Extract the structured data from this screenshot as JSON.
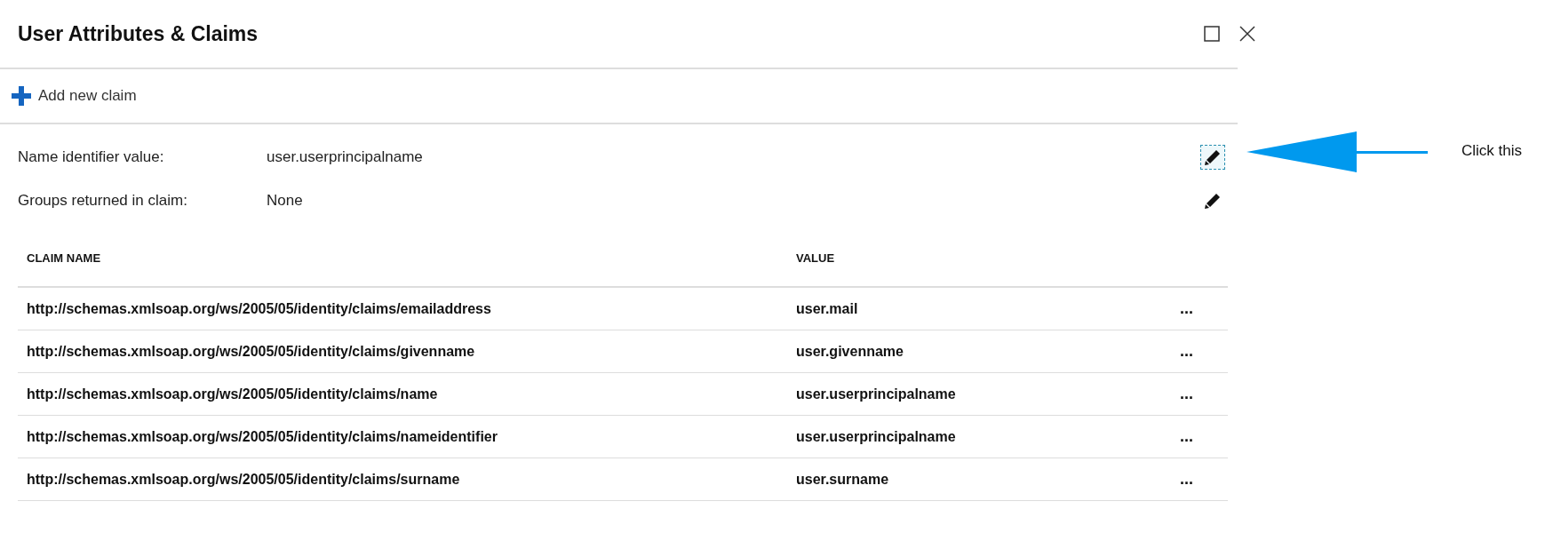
{
  "blade": {
    "title": "User Attributes & Claims"
  },
  "toolbar": {
    "add_label": "Add new claim"
  },
  "settings": [
    {
      "label": "Name identifier value:",
      "value": "user.userprincipalname",
      "focused": true
    },
    {
      "label": "Groups returned in claim:",
      "value": "None",
      "focused": false
    }
  ],
  "table": {
    "columns": [
      "CLAIM NAME",
      "VALUE"
    ],
    "rows": [
      {
        "claim_name": "http://schemas.xmlsoap.org/ws/2005/05/identity/claims/emailaddress",
        "value": "user.mail",
        "more": "..."
      },
      {
        "claim_name": "http://schemas.xmlsoap.org/ws/2005/05/identity/claims/givenname",
        "value": "user.givenname",
        "more": "..."
      },
      {
        "claim_name": "http://schemas.xmlsoap.org/ws/2005/05/identity/claims/name",
        "value": "user.userprincipalname",
        "more": "..."
      },
      {
        "claim_name": "http://schemas.xmlsoap.org/ws/2005/05/identity/claims/nameidentifier",
        "value": "user.userprincipalname",
        "more": "..."
      },
      {
        "claim_name": "http://schemas.xmlsoap.org/ws/2005/05/identity/claims/surname",
        "value": "user.surname",
        "more": "..."
      }
    ]
  },
  "annotation": {
    "text": "Click this"
  }
}
